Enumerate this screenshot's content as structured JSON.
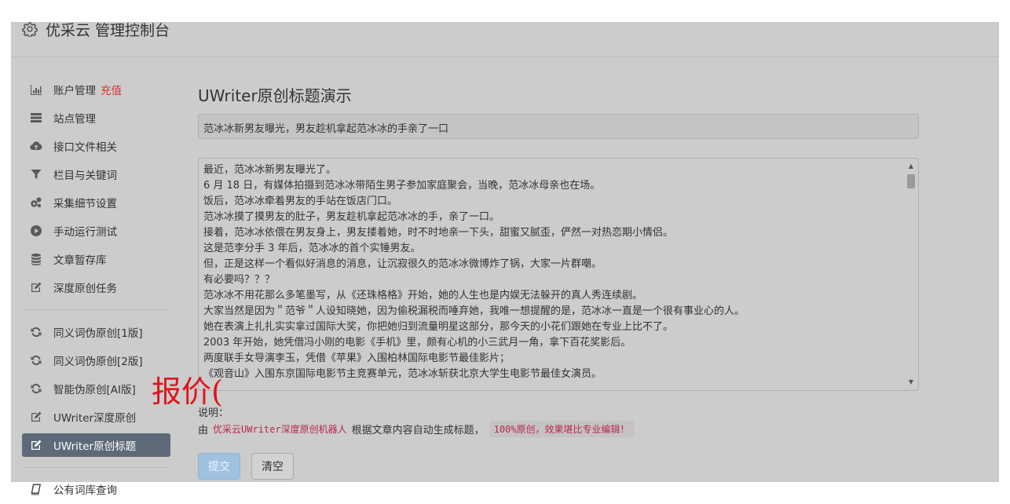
{
  "app": {
    "title": "优采云 管理控制台"
  },
  "sidebar": {
    "items": [
      {
        "label": "账户管理",
        "tag": "充值",
        "icon": "bar-chart-icon"
      },
      {
        "label": "站点管理",
        "icon": "server-icon"
      },
      {
        "label": "接口文件相关",
        "icon": "cloud-upload-icon"
      },
      {
        "label": "栏目与关键词",
        "icon": "filter-icon"
      },
      {
        "label": "采集细节设置",
        "icon": "cogs-icon"
      },
      {
        "label": "手动运行测试",
        "icon": "play-icon"
      },
      {
        "label": "文章暂存库",
        "icon": "database-icon"
      },
      {
        "label": "深度原创任务",
        "icon": "edit-icon"
      },
      {
        "label": "同义词伪原创[1版]",
        "icon": "refresh-icon"
      },
      {
        "label": "同义词伪原创[2版]",
        "icon": "refresh-icon"
      },
      {
        "label": "智能伪原创[AI版]",
        "icon": "refresh-icon"
      },
      {
        "label": "UWriter深度原创",
        "icon": "edit-icon"
      },
      {
        "label": "UWriter原创标题",
        "icon": "edit-icon",
        "active": true
      },
      {
        "label": "公有词库查询",
        "icon": "book-icon"
      }
    ]
  },
  "main": {
    "title": "UWriter原创标题演示",
    "title_value": "范冰冰新男友曝光，男友趁机拿起范冰冰的手亲了一口",
    "article_lines": [
      "最近，范冰冰新男友曝光了。",
      "6 月 18 日，有媒体拍摄到范冰冰带陌生男子参加家庭聚会，当晚，范冰冰母亲也在场。",
      "饭后，范冰冰牵着男友的手站在饭店门口。",
      "范冰冰摸了摸男友的肚子，男友趁机拿起范冰冰的手，亲了一口。",
      "接着，范冰冰依偎在男友身上，男友搂着她，时不时地亲一下头，甜蜜又腻歪，俨然一对热恋期小情侣。",
      "这是范李分手 3 年后，范冰冰的首个实锤男友。",
      "但，正是这样一个看似好消息的消息，让沉寂很久的范冰冰微博炸了锅，大家一片群嘲。",
      "有必要吗？？？",
      "范冰冰不用花那么多笔墨写，从《还珠格格》开始，她的人生也是内娱无法躲开的真人秀连续剧。",
      "大家当然是因为＂范爷＂人设知晓她，因为偷税漏税而唾弃她，我唯一想提醒的是，范冰冰一直是一个很有事业心的人。",
      "她在表演上扎扎实实拿过国际大奖，你把她归到流量明星这部分，那今天的小花们跟她在专业上比不了。",
      "2003 年开始，她凭借冯小刚的电影《手机》里，颇有心机的小三武月一角，拿下百花奖影后。",
      "两度联手女导演李玉，凭借《苹果》入围柏林国际电影节最佳影片；",
      "《观音山》入围东京国际电影节主竞赛单元，范冰冰斩获北京大学生电影节最佳女演员。"
    ],
    "note_label": "说明：",
    "note_prefix": "由",
    "note_highlight": "优采云UWriter深度原创机器人",
    "note_middle": "根据文章内容自动生成标题，",
    "note_code": "100%原创，效果堪比专业编辑！",
    "submit_label": "提交",
    "clear_label": "清空"
  },
  "overlay_text": "报价(",
  "colors": {
    "accent": "#5e6a78",
    "tag": "#d9342b",
    "overlay_text": "#e0141e"
  }
}
